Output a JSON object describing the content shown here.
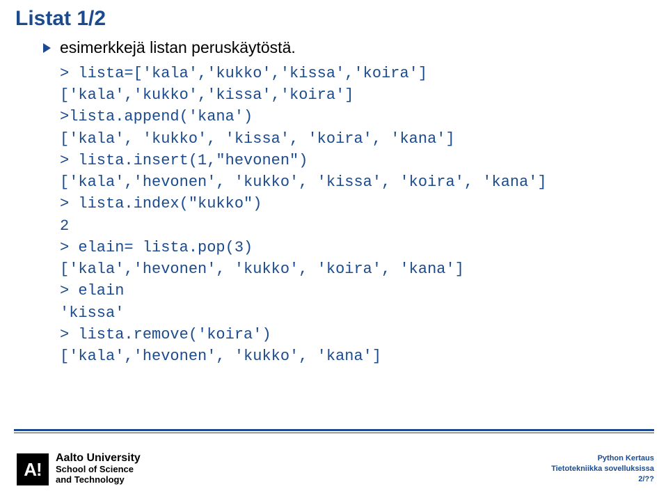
{
  "title": "Listat 1/2",
  "bullet": "esimerkkejä listan peruskäytöstä.",
  "code": {
    "l1": "> lista=['kala','kukko','kissa','koira']",
    "l2": "['kala','kukko','kissa','koira']",
    "l3": ">lista.append('kana')",
    "l4": "['kala', 'kukko', 'kissa', 'koira', 'kana']",
    "l5": "> lista.insert(1,\"hevonen\")",
    "l6": "['kala','hevonen', 'kukko', 'kissa', 'koira', 'kana']",
    "l7": "> lista.index(\"kukko\")",
    "l8": "2",
    "l9": "> elain= lista.pop(3)",
    "l10": "['kala','hevonen', 'kukko', 'koira', 'kana']",
    "l11": "> elain",
    "l12": "'kissa'",
    "l13": "> lista.remove('koira')",
    "l14": "['kala','hevonen', 'kukko', 'kana']"
  },
  "logo": {
    "mark": "A!",
    "line1": "Aalto University",
    "line2": "School of Science",
    "line3": "and Technology"
  },
  "footer": {
    "line1": "Python Kertaus",
    "line2": "Tietotekniikka sovelluksissa",
    "line3": "2/??"
  }
}
